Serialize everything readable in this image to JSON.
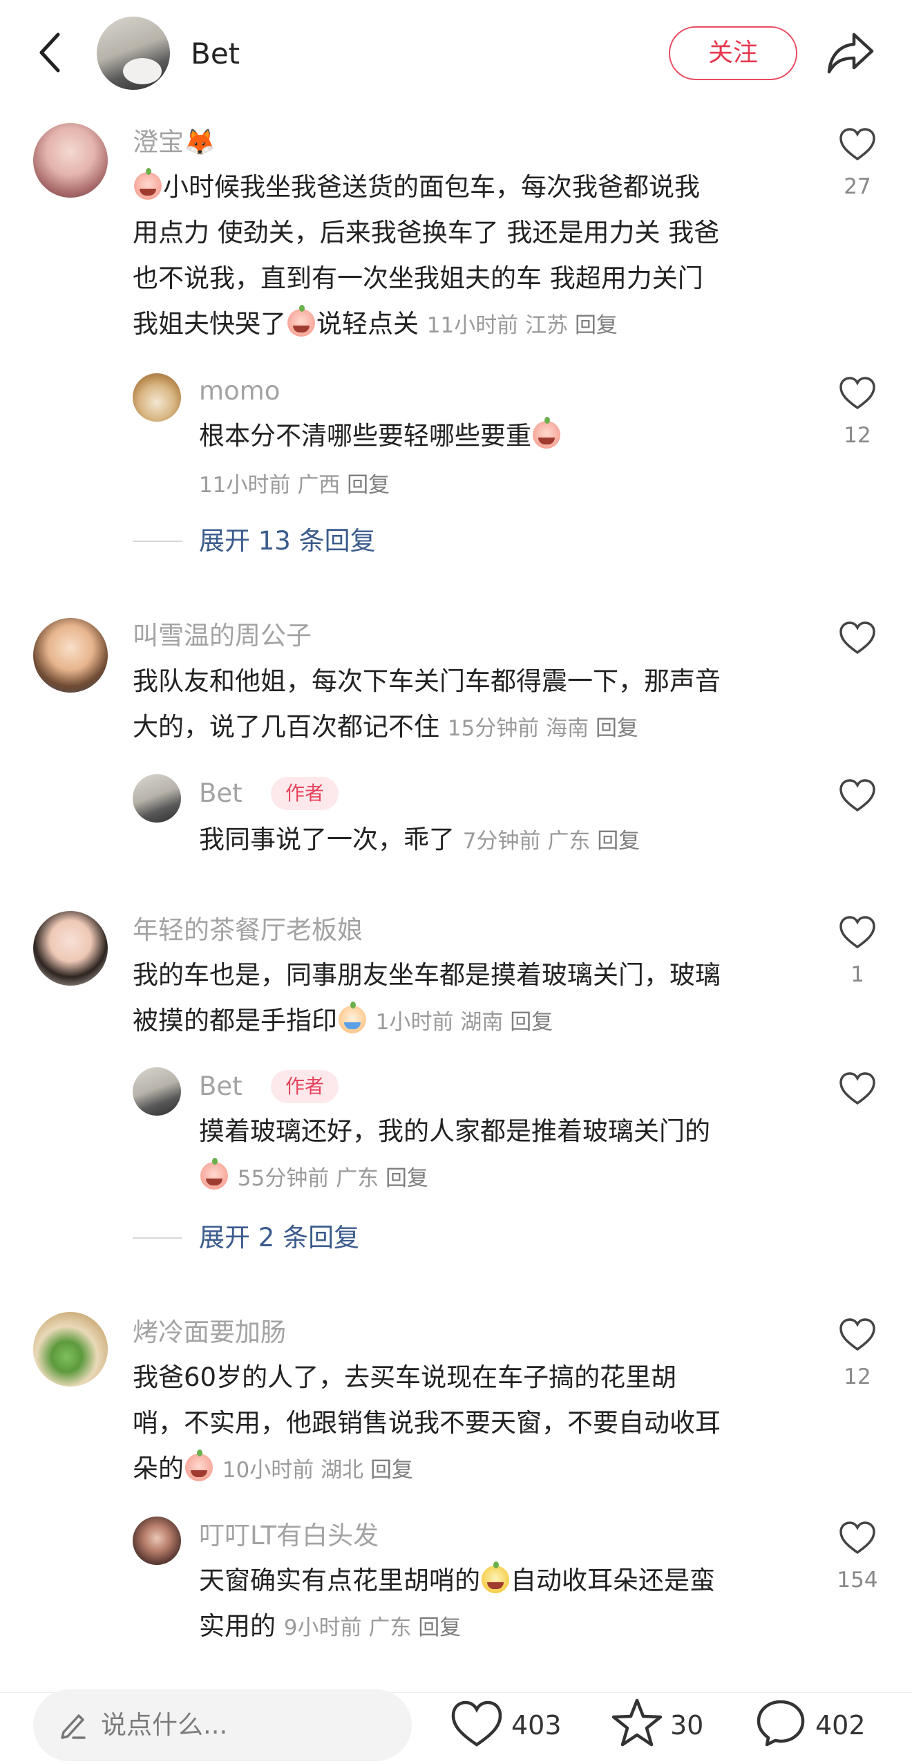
{
  "header": {
    "name": "Bet",
    "follow_label": "关注"
  },
  "comments": [
    {
      "user": "澄宝🦊",
      "text_parts": [
        "小时候我坐我爸送货的面包车，每次我爸都说我",
        "用点力 使劲关，后来我爸换车了 我还是用力关 我爸",
        "也不说我，直到有一次坐我姐夫的车 我超用力关门",
        "我姐夫快哭了",
        "说轻点关"
      ],
      "time": "11小时前",
      "location": "江苏",
      "reply_label": "回复",
      "likes": "27",
      "reply": {
        "user": "momo",
        "text": "根本分不清哪些要轻哪些要重",
        "time": "11小时前",
        "location": "广西",
        "reply_label": "回复",
        "likes": "12"
      },
      "expand": "展开 13 条回复"
    },
    {
      "user": "叫雪温的周公子",
      "text_lines": [
        "我队友和他姐，每次下车关门车都得震一下，那声音",
        "大的，说了几百次都记不住"
      ],
      "time": "15分钟前",
      "location": "海南",
      "reply_label": "回复",
      "likes": "",
      "reply": {
        "user": "Bet",
        "badge": "作者",
        "text": "我同事说了一次，乖了",
        "time": "7分钟前",
        "location": "广东",
        "reply_label": "回复",
        "likes": ""
      }
    },
    {
      "user": "年轻的茶餐厅老板娘",
      "text_lines": [
        "我的车也是，同事朋友坐车都是摸着玻璃关门，玻璃",
        "被摸的都是手指印"
      ],
      "time": "1小时前",
      "location": "湖南",
      "reply_label": "回复",
      "likes": "1",
      "reply": {
        "user": "Bet",
        "badge": "作者",
        "text": "摸着玻璃还好，我的人家都是推着玻璃关门的",
        "time": "55分钟前",
        "location": "广东",
        "reply_label": "回复",
        "likes": ""
      },
      "expand": "展开 2 条回复"
    },
    {
      "user": "烤冷面要加肠",
      "text_lines": [
        "我爸60岁的人了，去买车说现在车子搞的花里胡",
        "哨，不实用，他跟销售说我不要天窗，不要自动收耳",
        "朵的"
      ],
      "time": "10小时前",
      "location": "湖北",
      "reply_label": "回复",
      "likes": "12",
      "reply": {
        "user": "叮叮LT有白头发",
        "text_parts": [
          "天窗确实有点花里胡哨的",
          "自动收耳朵还是蛮",
          "实用的"
        ],
        "time": "9小时前",
        "location": "广东",
        "reply_label": "回复",
        "likes": "154"
      }
    }
  ],
  "bottom": {
    "placeholder": "说点什么...",
    "likes": "403",
    "stars": "30",
    "comments": "402"
  }
}
